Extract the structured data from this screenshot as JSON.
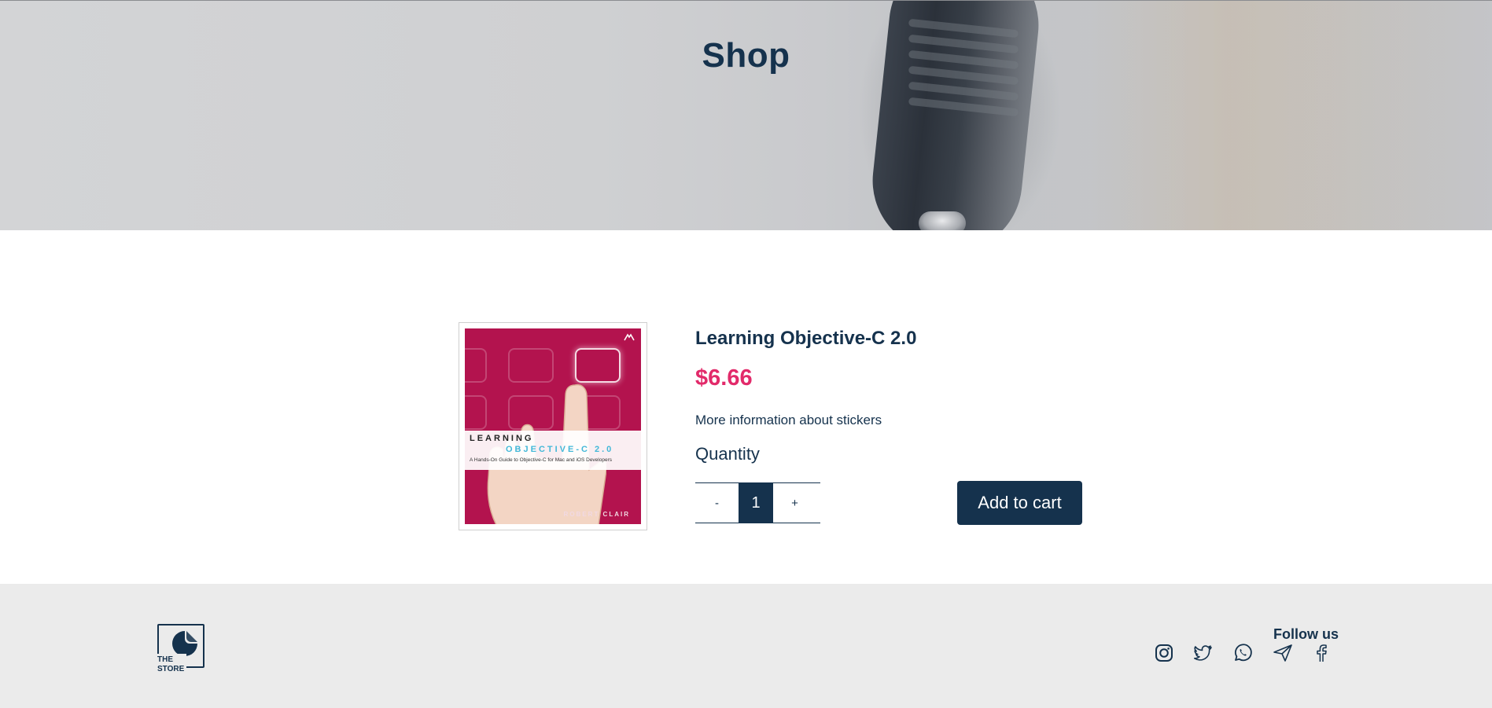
{
  "hero": {
    "title": "Shop"
  },
  "product": {
    "name": "Learning Objective-C 2.0",
    "price": "$6.66",
    "info_link": "More information about stickers",
    "quantity_label": "Quantity",
    "quantity_value": "1",
    "decrement_label": "-",
    "increment_label": "+",
    "add_to_cart_label": "Add to cart",
    "cover": {
      "line1": "LEARNING",
      "line2": "OBJECTIVE-C 2.0",
      "subtitle": "A Hands-On Guide to Objective-C for Mac and iOS Developers",
      "author": "ROBERT CLAIR"
    }
  },
  "footer": {
    "logo_text_line1": "THE",
    "logo_text_line2": "STORE",
    "follow_label": "Follow us",
    "social_icons": [
      "instagram-icon",
      "twitter-icon",
      "whatsapp-icon",
      "telegram-icon",
      "facebook-icon"
    ]
  },
  "colors": {
    "primary": "#15324d",
    "price": "#e22a6a",
    "footer_bg": "#ebebeb"
  }
}
